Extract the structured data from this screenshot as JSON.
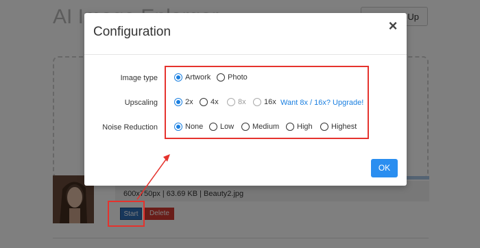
{
  "background": {
    "title": "AI Image Enlarger",
    "signup_label": "Sign Up",
    "file_info": "600x750px | 63.69 KB | Beauty2.jpg",
    "start_label": "Start",
    "delete_label": "Delete"
  },
  "modal": {
    "title": "Configuration",
    "close_icon": "×",
    "ok_label": "OK",
    "rows": {
      "image_type": {
        "label": "Image type",
        "options": [
          {
            "label": "Artwork",
            "selected": true
          },
          {
            "label": "Photo",
            "selected": false
          }
        ]
      },
      "upscaling": {
        "label": "Upscaling",
        "options": [
          {
            "label": "2x",
            "selected": true
          },
          {
            "label": "4x",
            "selected": false
          },
          {
            "label": "8x",
            "selected": false,
            "disabled": true
          },
          {
            "label": "16x",
            "selected": false,
            "disabled": true
          }
        ],
        "upgrade_link": "Want 8x / 16x? Upgrade!"
      },
      "noise_reduction": {
        "label": "Noise Reduction",
        "options": [
          {
            "label": "None",
            "selected": true
          },
          {
            "label": "Low",
            "selected": false
          },
          {
            "label": "Medium",
            "selected": false
          },
          {
            "label": "High",
            "selected": false
          },
          {
            "label": "Highest",
            "selected": false
          }
        ]
      }
    }
  },
  "colors": {
    "accent": "#1a7fe0",
    "annotation": "#e5322d",
    "ok_button": "#2a8ef0"
  }
}
